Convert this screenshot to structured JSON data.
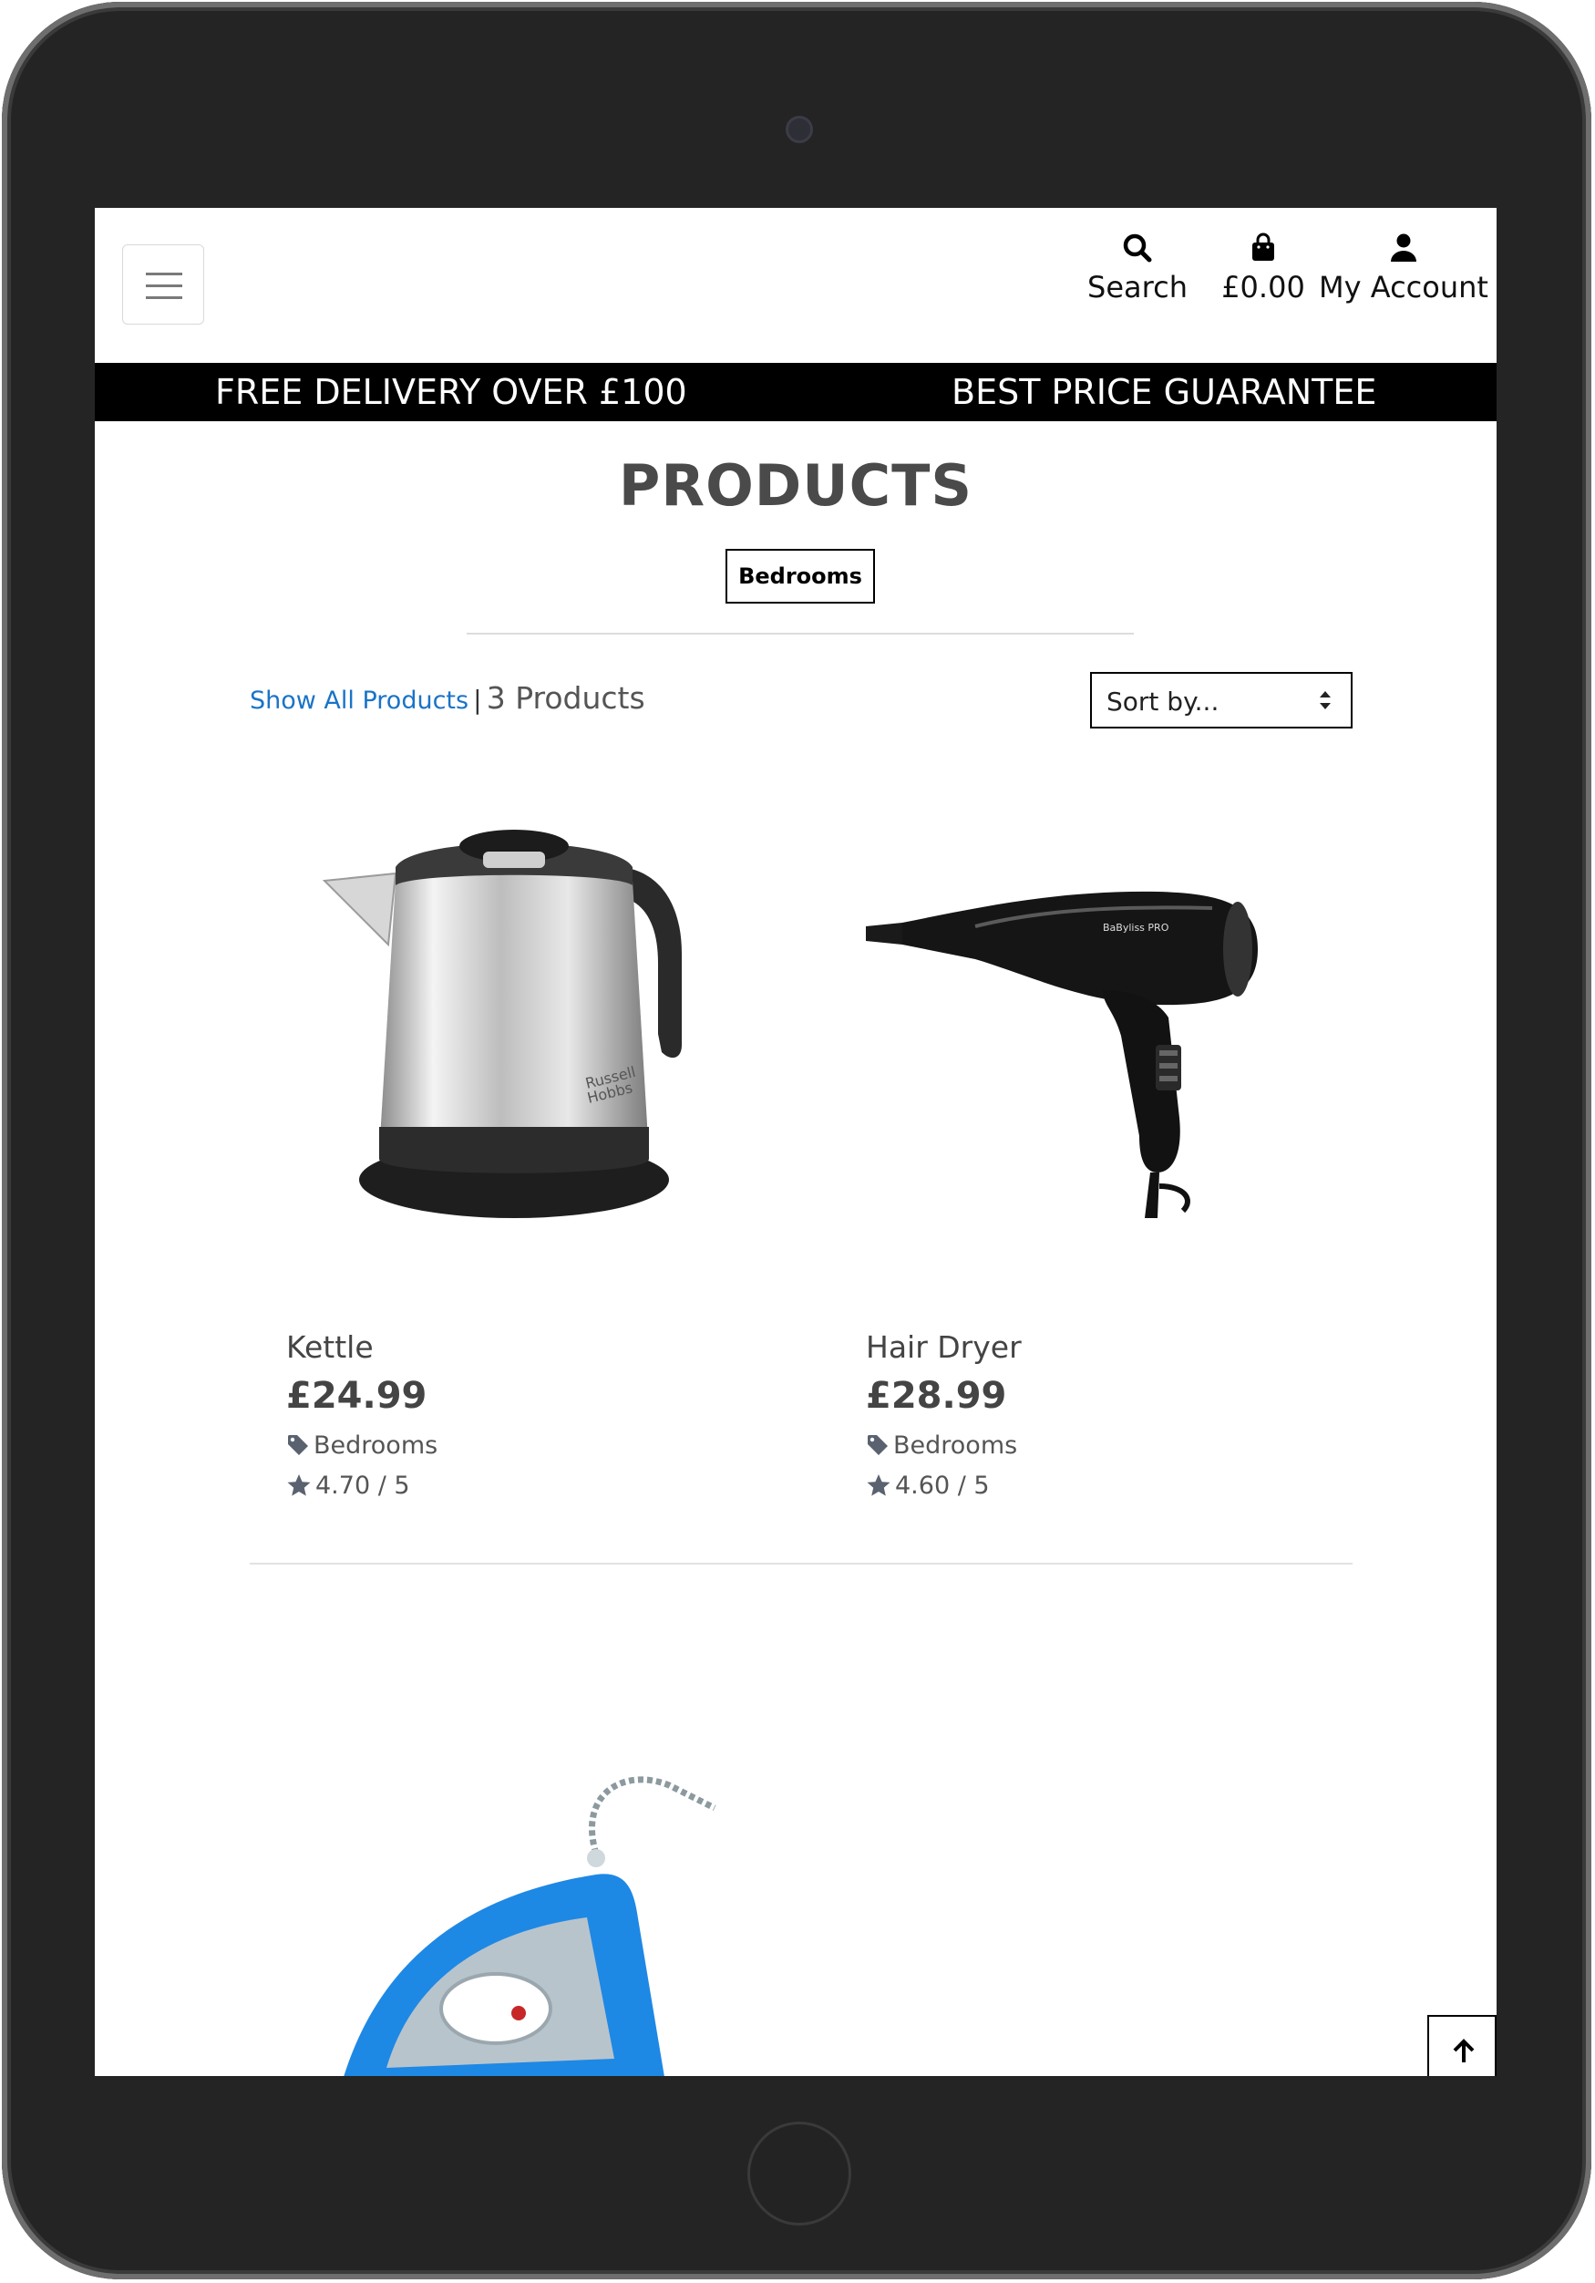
{
  "navbar": {
    "search_label": "Search",
    "bag_total": "£0.00",
    "account_label": "My Account"
  },
  "promo": {
    "left": "FREE DELIVERY OVER £100",
    "right": "BEST PRICE GUARANTEE"
  },
  "page": {
    "title": "PRODUCTS",
    "category_badge": "Bedrooms",
    "show_all": "Show All Products",
    "separator": "|",
    "count": "3 Products",
    "sort_placeholder": "Sort by..."
  },
  "products": [
    {
      "name": "Kettle",
      "price": "£24.99",
      "category": "Bedrooms",
      "rating": "4.70 / 5",
      "image_icon": "kettle-image"
    },
    {
      "name": "Hair Dryer",
      "price": "£28.99",
      "category": "Bedrooms",
      "rating": "4.60 / 5",
      "image_icon": "hair-dryer-image"
    },
    {
      "image_icon": "iron-image"
    }
  ],
  "colors": {
    "promo_bar": "#000000",
    "link": "#1a73c8",
    "text": "#444444",
    "tablet_frame": "#242424"
  }
}
